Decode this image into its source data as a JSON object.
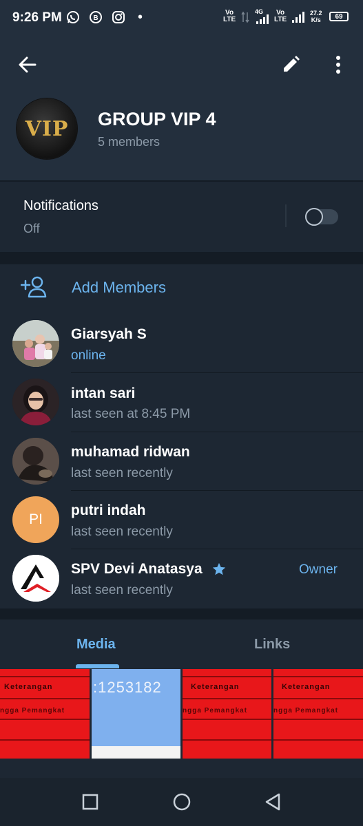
{
  "status_bar": {
    "time": "9:26 PM",
    "net1_top": "Vo",
    "net1_bottom": "LTE",
    "net_4g": "4G",
    "net2_top": "Vo",
    "net2_bottom": "LTE",
    "speed_top": "27.2",
    "speed_bottom": "K/s",
    "battery": "69",
    "icons": [
      "whatsapp-icon",
      "business-icon",
      "instagram-icon"
    ]
  },
  "header": {
    "avatar_text": "VIP",
    "title": "GROUP VIP 4",
    "subtitle": "5 members"
  },
  "notifications": {
    "title": "Notifications",
    "value": "Off",
    "enabled": false
  },
  "members": {
    "add_label": "Add Members",
    "list": [
      {
        "name": "Giarsyah S",
        "status": "online"
      },
      {
        "name": "intan sari",
        "status": "last seen at 8:45 PM"
      },
      {
        "name": "muhamad ridwan",
        "status": "last seen recently"
      },
      {
        "name": "putri indah",
        "status": "last seen recently",
        "initials": "PI"
      },
      {
        "name": "SPV Devi Anatasya",
        "status": "last seen recently",
        "role": "Owner"
      }
    ]
  },
  "tabs": {
    "items": [
      "Media",
      "Links"
    ],
    "active": "Media"
  },
  "media": {
    "thumb1_title": "Keterangan",
    "thumb1_line": "ngga  Pemangkat",
    "thumb2_number": ":1253182",
    "thumb3_title": "Keterangan",
    "thumb3_line": "ngga  Pemangkat",
    "thumb4_title": "Keterangan",
    "thumb4_line": "ngga  Pemangkat"
  },
  "colors": {
    "accent": "#6cb4ee",
    "background": "#1d2733",
    "header": "#232f3d",
    "secondary_text": "#8c9aa8"
  }
}
